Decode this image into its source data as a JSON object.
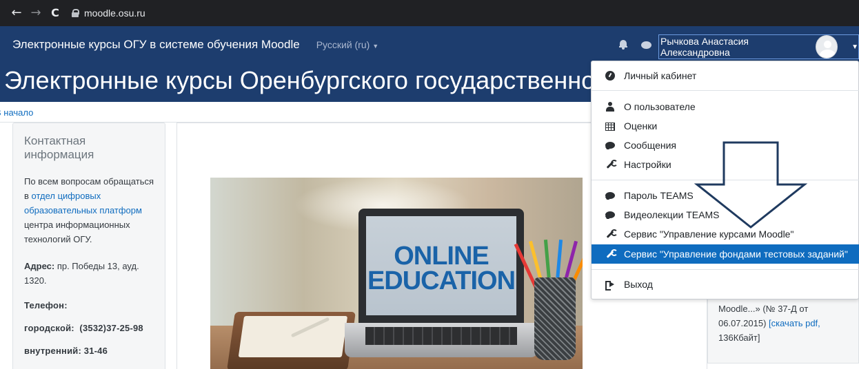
{
  "browser": {
    "back_glyph": "←",
    "forward_glyph": "→",
    "reload_glyph": "C",
    "url": "moodle.osu.ru"
  },
  "navbar": {
    "site_name": "Электронные курсы ОГУ в системе обучения Moodle",
    "language": "Русский (ru)",
    "user_name": "Рычкова Анастасия Александровна",
    "caret": "▼"
  },
  "header": {
    "title": "Электронные курсы Оренбургского государственного университета"
  },
  "breadcrumb": {
    "home": "В начало"
  },
  "contact_block": {
    "title": "Контактная информация",
    "text_before_link": "По всем вопросам обращаться в ",
    "link": "отдел цифровых образовательных платформ",
    "text_after_link": " центра информационных технологий ОГУ.",
    "address_label": "Адрес:",
    "address_value": " пр. Победы 13, ауд. 1320.",
    "phone_label": "Телефон:",
    "city_phone": "городской:  (3532)37-25-98",
    "internal_phone": "внутренний: 31-46"
  },
  "hero": {
    "line1": "ONLINE",
    "line2": "EDUCATION"
  },
  "right_block": {
    "text1": "Moodle...» (№ 37-Д от 06.07.2015) ",
    "link": "[скачать pdf,",
    "text2": " 136Кбайт]"
  },
  "user_dropdown": {
    "items": [
      {
        "label": "Личный кабинет",
        "icon": "dashboard-icon"
      },
      {
        "label": "О пользователе",
        "icon": "user-icon"
      },
      {
        "label": "Оценки",
        "icon": "table-icon"
      },
      {
        "label": "Сообщения",
        "icon": "chat-icon"
      },
      {
        "label": "Настройки",
        "icon": "wrench-icon"
      },
      {
        "label": "Пароль TEAMS",
        "icon": "chat-icon"
      },
      {
        "label": "Видеолекции TEAMS",
        "icon": "chat-icon"
      },
      {
        "label": "Сервис \"Управление курсами Moodle\"",
        "icon": "wrench-icon"
      },
      {
        "label": "Сервис \"Управление фондами тестовых заданий\"",
        "icon": "wrench-icon",
        "active": true
      },
      {
        "label": "Выход",
        "icon": "logout-icon"
      }
    ]
  },
  "colors": {
    "navbar": "#1d3d6e",
    "accent": "#0f6cbf",
    "annotation_arrow": "#1f3a5f"
  }
}
